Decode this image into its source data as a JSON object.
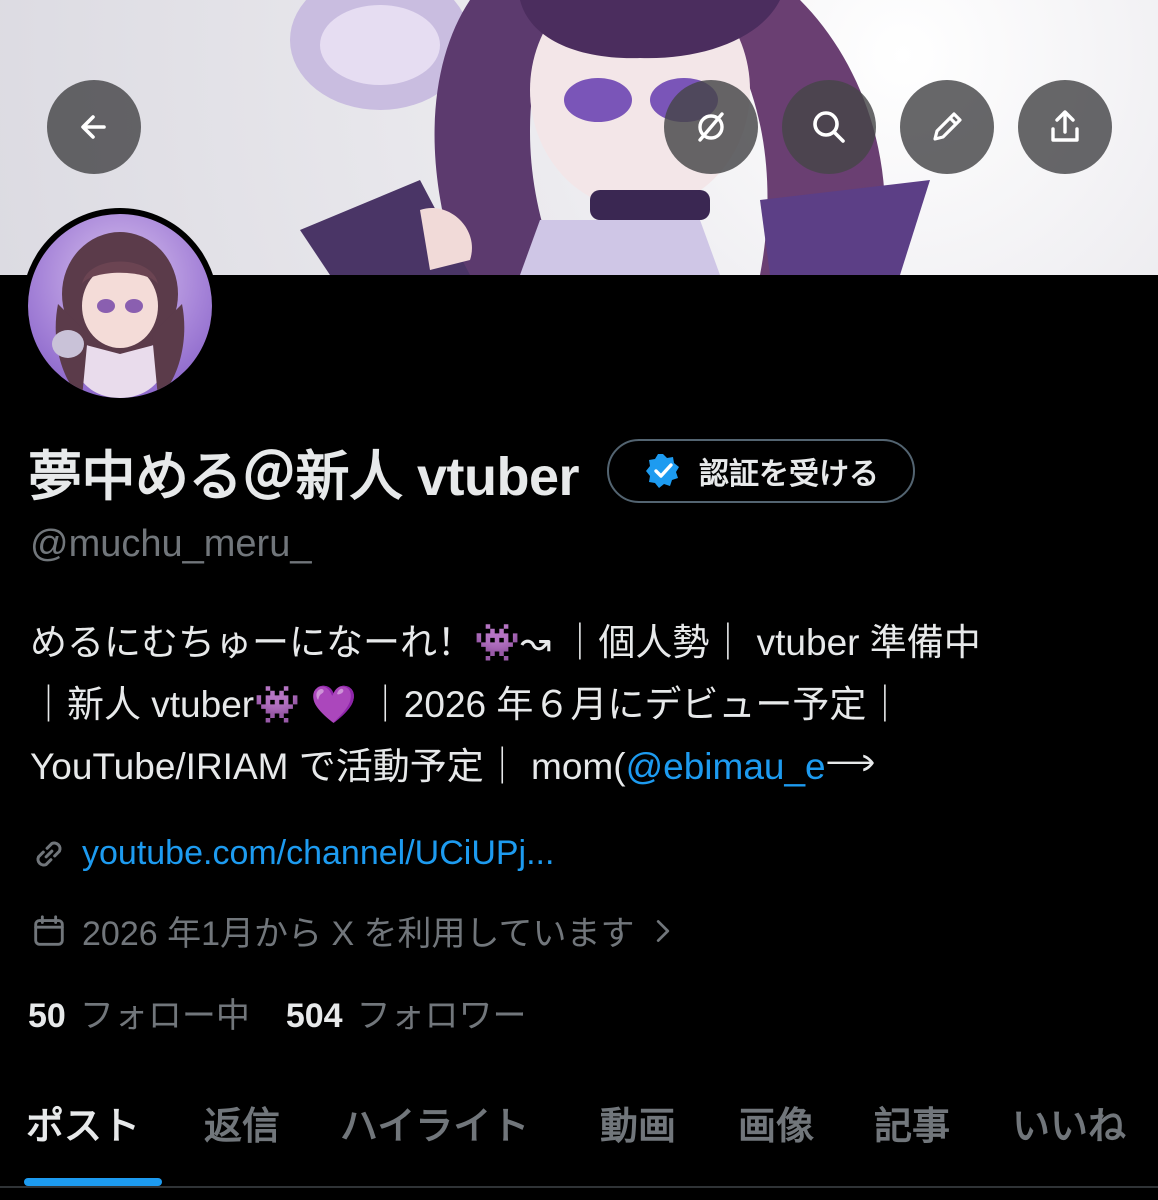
{
  "profile": {
    "display_name": "夢中める＠新人 vtuber",
    "handle": "@muchu_meru_",
    "verify_label": "認証を受ける",
    "bio_lines": [
      "めるにむちゅーになーれ！👾↝ ｜個人勢｜ vtuber 準備中",
      "｜新人 vtuber👾 💜 ｜2026 年６月にデビュー予定｜",
      "YouTube/IRIAM で活動予定｜ mom("
    ],
    "bio_mention": "@ebimau_e",
    "bio_tail": "𐃘",
    "link": "youtube.com/channel/UCiUPj...",
    "joined": "2026 年1月から X を利用しています",
    "following_count": "50",
    "following_label": "フォロー中",
    "followers_count": "504",
    "followers_label": "フォロワー"
  },
  "tabs": [
    "ポスト",
    "返信",
    "ハイライト",
    "動画",
    "画像",
    "記事",
    "いいね"
  ],
  "active_tab": "ポスト",
  "icons": {
    "back": "arrow-left-icon",
    "grok": "grok-icon",
    "search": "search-icon",
    "edit": "pencil-icon",
    "share": "share-icon",
    "verified": "verified-badge-icon",
    "link": "link-icon",
    "calendar": "calendar-icon",
    "chevron": "chevron-right-icon"
  },
  "colors": {
    "background": "#000000",
    "text": "#e7e9ea",
    "muted": "#71767b",
    "accent": "#1d9bf0",
    "button_overlay": "#464648"
  }
}
